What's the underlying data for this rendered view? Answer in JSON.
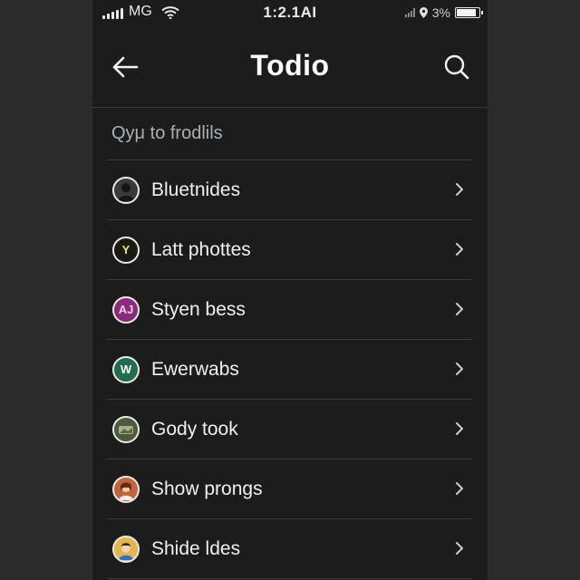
{
  "status_bar": {
    "carrier": "MG",
    "time": "1:2.1AI",
    "battery": "3%",
    "battery_level": 0.95
  },
  "header": {
    "title": "Todio",
    "back_icon": "arrow-left-icon",
    "search_icon": "search-icon"
  },
  "section": {
    "heading": "Qyμ to frodlils"
  },
  "list": {
    "items": [
      {
        "label": "Bluetnides",
        "avatar_glyph": "",
        "avatar_color": "#3a3a3a"
      },
      {
        "label": "Latt phottes",
        "avatar_glyph": "Y",
        "avatar_color": "#1a1a10"
      },
      {
        "label": "Styen bess",
        "avatar_glyph": "AJ",
        "avatar_color": "#8a2a7a"
      },
      {
        "label": "Ewerwabs",
        "avatar_glyph": "W",
        "avatar_color": "#1f6e4e"
      },
      {
        "label": "Gody took",
        "avatar_glyph": "",
        "avatar_color": "#4d5a3c"
      },
      {
        "label": "Show prongs",
        "avatar_glyph": "",
        "avatar_color": "#c2663a"
      },
      {
        "label": "Shide ldes",
        "avatar_glyph": "",
        "avatar_color": "#e2b64a"
      }
    ]
  },
  "colors": {
    "background": "#1c1c1c",
    "text": "#f0f0f0",
    "heading": "#a9b0b4",
    "divider": "#3b3b3b"
  }
}
